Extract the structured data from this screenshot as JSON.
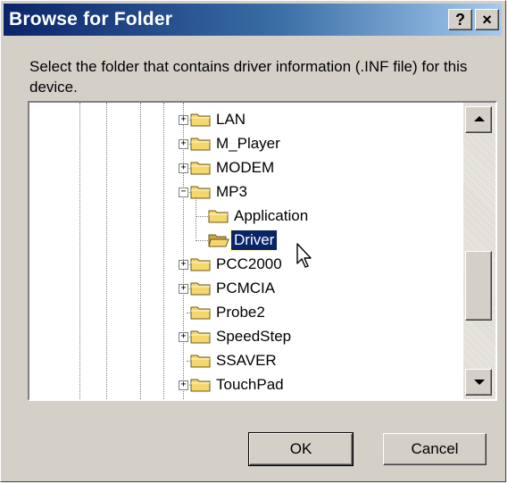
{
  "dialog": {
    "title": "Browse for Folder",
    "help_label": "?",
    "close_label": "×",
    "instruction": "Select the folder that contains driver information (.INF file) for this device.",
    "ok_label": "OK",
    "cancel_label": "Cancel"
  },
  "tree": {
    "items": [
      {
        "label": "LAN",
        "expander": "+",
        "selected": false
      },
      {
        "label": "M_Player",
        "expander": "+",
        "selected": false
      },
      {
        "label": "MODEM",
        "expander": "+",
        "selected": false
      },
      {
        "label": "MP3",
        "expander": "−",
        "selected": false
      },
      {
        "label": "Application",
        "expander": "",
        "selected": false
      },
      {
        "label": "Driver",
        "expander": "",
        "selected": true
      },
      {
        "label": "PCC2000",
        "expander": "+",
        "selected": false
      },
      {
        "label": "PCMCIA",
        "expander": "+",
        "selected": false
      },
      {
        "label": "Probe2",
        "expander": "",
        "selected": false
      },
      {
        "label": "SpeedStep",
        "expander": "+",
        "selected": false
      },
      {
        "label": "SSAVER",
        "expander": "",
        "selected": false
      },
      {
        "label": "TouchPad",
        "expander": "+",
        "selected": false
      }
    ]
  },
  "colors": {
    "title_start": "#0a246a",
    "title_end": "#a6caf0",
    "face": "#d4d0c8",
    "selection": "#0a246a",
    "folder": "#f5d76e"
  },
  "icons": {
    "folder": "folder-icon",
    "open_folder": "open-folder-icon",
    "cursor": "mouse-pointer-icon"
  }
}
